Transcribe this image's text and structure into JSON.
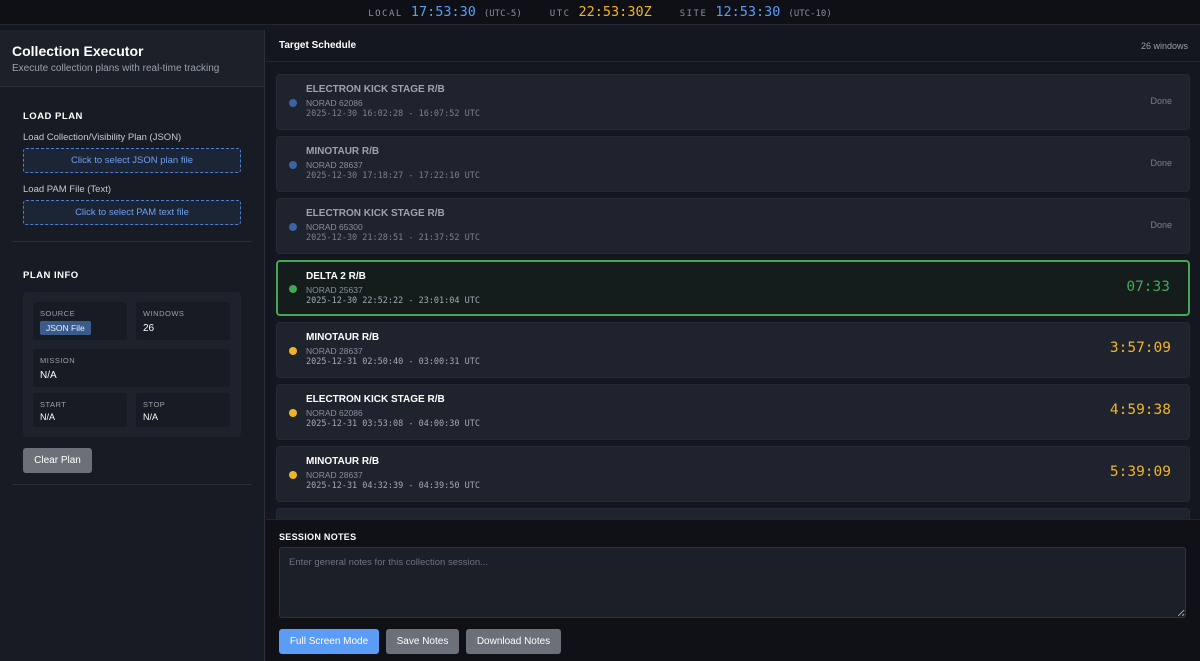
{
  "clocks": {
    "local": {
      "label": "LOCAL",
      "time": "17:53:30",
      "tz": "(UTC-5)",
      "color": "#5b9cf6"
    },
    "utc": {
      "label": "UTC",
      "time": "22:53:30Z",
      "tz": "",
      "color": "#f0b429"
    },
    "site": {
      "label": "SITE",
      "time": "12:53:30",
      "tz": "(UTC-10)",
      "color": "#5b9cf6"
    }
  },
  "sidebar": {
    "title": "Collection Executor",
    "subtitle": "Execute collection plans with real-time tracking",
    "load_plan": {
      "title": "LOAD PLAN",
      "json_label": "Load Collection/Visibility Plan (JSON)",
      "json_button": "Click to select JSON plan file",
      "pam_label": "Load PAM File (Text)",
      "pam_button": "Click to select PAM text file"
    },
    "plan_info": {
      "title": "PLAN INFO",
      "source_label": "SOURCE",
      "source_value": "JSON File",
      "windows_label": "WINDOWS",
      "windows_value": "26",
      "mission_label": "MISSION",
      "mission_value": "N/A",
      "start_label": "START",
      "start_value": "N/A",
      "stop_label": "STOP",
      "stop_value": "N/A",
      "clear_button": "Clear Plan"
    }
  },
  "schedule": {
    "title": "Target Schedule",
    "count": "26 windows",
    "colors": {
      "done": "#3d63a6",
      "active": "#47a656",
      "upcoming": "#f0b429"
    },
    "items": [
      {
        "name": "ELECTRON KICK STAGE R/B",
        "norad": "NORAD 62086",
        "window": "2025-12-30 16:02:28 - 16:07:52 UTC",
        "status": "Done",
        "state": "done"
      },
      {
        "name": "MINOTAUR R/B",
        "norad": "NORAD 28637",
        "window": "2025-12-30 17:18:27 - 17:22:10 UTC",
        "status": "Done",
        "state": "done"
      },
      {
        "name": "ELECTRON KICK STAGE R/B",
        "norad": "NORAD 65300",
        "window": "2025-12-30 21:28:51 - 21:37:52 UTC",
        "status": "Done",
        "state": "done"
      },
      {
        "name": "DELTA 2 R/B",
        "norad": "NORAD 25637",
        "window": "2025-12-30 22:52:22 - 23:01:04 UTC",
        "status": "07:33",
        "state": "active"
      },
      {
        "name": "MINOTAUR R/B",
        "norad": "NORAD 28637",
        "window": "2025-12-31 02:50:40 - 03:00:31 UTC",
        "status": "3:57:09",
        "state": "upcoming"
      },
      {
        "name": "ELECTRON KICK STAGE R/B",
        "norad": "NORAD 62086",
        "window": "2025-12-31 03:53:08 - 04:00:30 UTC",
        "status": "4:59:38",
        "state": "upcoming"
      },
      {
        "name": "MINOTAUR R/B",
        "norad": "NORAD 28637",
        "window": "2025-12-31 04:32:39 - 04:39:50 UTC",
        "status": "5:39:09",
        "state": "upcoming"
      },
      {
        "name": "",
        "norad": "",
        "window": "",
        "status": "",
        "state": "upcoming"
      }
    ]
  },
  "notes": {
    "title": "SESSION NOTES",
    "placeholder": "Enter general notes for this collection session...",
    "value": "",
    "fullscreen_button": "Full Screen Mode",
    "save_button": "Save Notes",
    "download_button": "Download Notes"
  }
}
